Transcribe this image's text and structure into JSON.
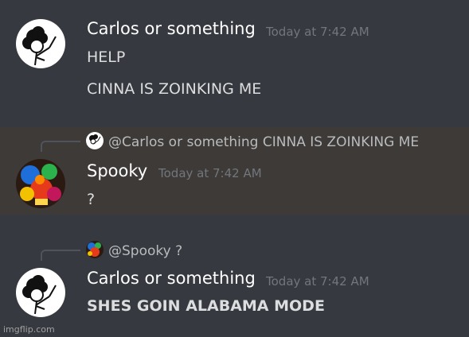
{
  "messages": [
    {
      "username": "Carlos or something",
      "timestamp": "Today at 7:42 AM",
      "avatar_icon": "stick-figure-afro-icon",
      "lines": [
        "HELP",
        "CINNA IS ZOINKING ME"
      ]
    },
    {
      "reply": {
        "mention": "@Carlos or something",
        "snippet": "CINNA IS ZOINKING ME",
        "avatar_icon": "stick-figure-afro-icon"
      },
      "username": "Spooky",
      "timestamp": "Today at 7:42 AM",
      "avatar_icon": "colorful-chaos-icon",
      "lines": [
        "?"
      ],
      "highlighted": true
    },
    {
      "reply": {
        "mention": "@Spooky",
        "snippet": "?",
        "avatar_icon": "colorful-chaos-icon"
      },
      "username": "Carlos or something",
      "timestamp": "Today at 7:42 AM",
      "avatar_icon": "stick-figure-afro-icon",
      "lines": [
        "SHES GOIN ALABAMA MODE"
      ]
    }
  ],
  "watermark": "imgflip.com",
  "colors": {
    "background": "#36393f",
    "highlight": "#3d3a37",
    "username": "#ffffff",
    "timestamp": "#72767d",
    "message_text": "#dcddde"
  }
}
